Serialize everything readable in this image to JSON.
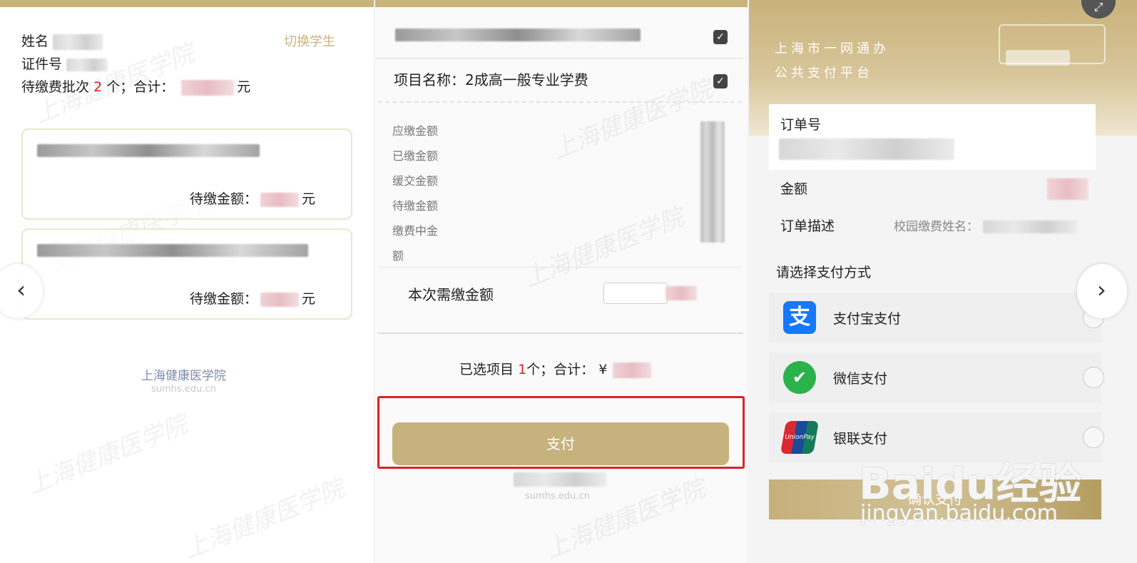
{
  "panel1": {
    "name_label": "姓名",
    "id_label": "证件号",
    "pending_prefix": "待缴费批次",
    "pending_count": "2",
    "pending_suffix": "个；合计：",
    "currency_unit": "元",
    "switch_student": "切换学生",
    "cards": [
      {
        "title_visible": "",
        "amount_label": "待缴金额：",
        "unit": "元"
      },
      {
        "title_visible": "",
        "amount_label": "待缴金额：",
        "unit": "元"
      }
    ],
    "school_name": "上海健康医学院",
    "domain": "sumhs.edu.cn"
  },
  "panel2": {
    "item_label": "项目名称：",
    "item_name": "2成高一般专业学费",
    "fields": [
      "应缴金额",
      "已缴金额",
      "缓交金额",
      "待缴金额",
      "缴费中金",
      "额"
    ],
    "need_pay_label": "本次需缴金额",
    "selected_prefix": "已选项目",
    "selected_count": "1",
    "selected_suffix": "个；合计：",
    "currency_symbol": "¥",
    "pay_button": "支付",
    "domain": "sumhs.edu.cn"
  },
  "panel3": {
    "header_line1": "上海市一网通办",
    "header_line2": "公共支付平台",
    "order_no_label": "订单号",
    "amount_label": "金额",
    "order_desc_label": "订单描述",
    "order_desc_value": "校园缴费姓名：",
    "choose_method": "请选择支付方式",
    "methods": [
      {
        "name": "支付宝支付",
        "icon": "alipay-icon"
      },
      {
        "name": "微信支付",
        "icon": "wechat-pay-icon"
      },
      {
        "name": "银联支付",
        "icon": "unionpay-icon"
      }
    ],
    "confirm_button": "确认支付"
  },
  "overlay": {
    "watermark_brand": "Baidu经验",
    "watermark_url": "jingyan.baidu.com",
    "prev_arrow": "‹",
    "next_arrow": "›"
  },
  "colors": {
    "gold": "#c8b37d",
    "alert_red": "#e0202a",
    "alipay": "#1677ff",
    "wechat": "#2ab34a"
  }
}
